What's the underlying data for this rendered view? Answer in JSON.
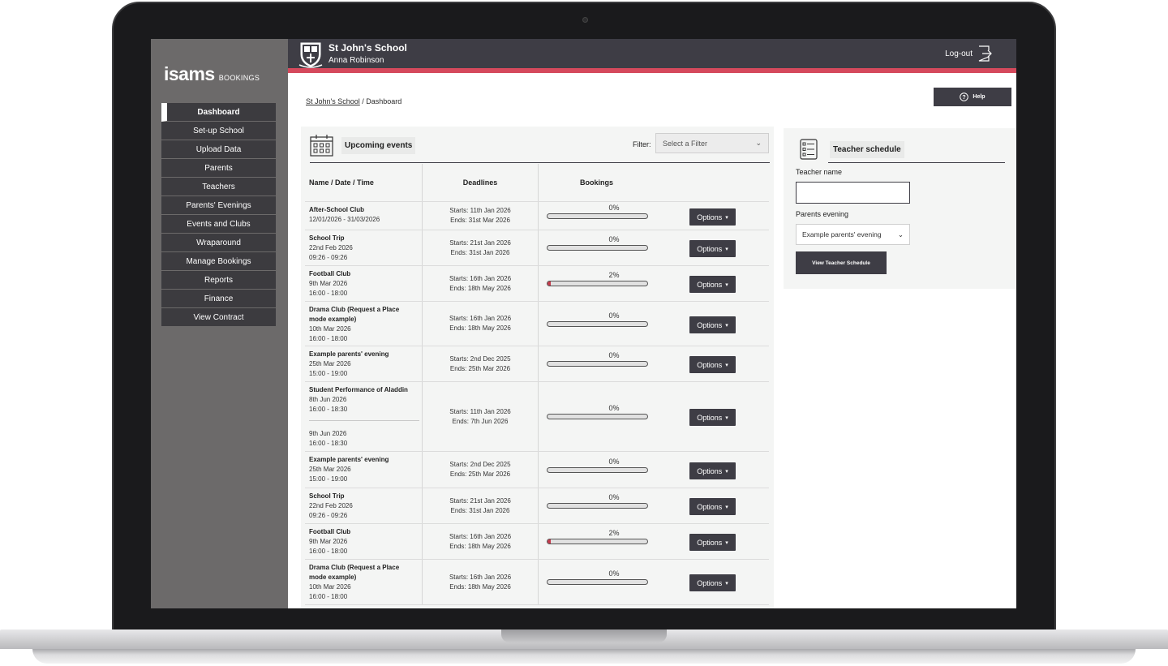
{
  "app": {
    "logo_main": "isams",
    "logo_sub": "BOOKINGS"
  },
  "sidebar": {
    "items": [
      {
        "label": "Dashboard"
      },
      {
        "label": "Set-up School"
      },
      {
        "label": "Upload Data"
      },
      {
        "label": "Parents"
      },
      {
        "label": "Teachers"
      },
      {
        "label": "Parents' Evenings"
      },
      {
        "label": "Events and Clubs"
      },
      {
        "label": "Wraparound"
      },
      {
        "label": "Manage Bookings"
      },
      {
        "label": "Reports"
      },
      {
        "label": "Finance"
      },
      {
        "label": "View Contract"
      }
    ],
    "active_index": 0
  },
  "header": {
    "school_name": "St John's School",
    "user_name": "Anna Robinson",
    "logout_label": "Log-out"
  },
  "breadcrumb": {
    "link": "St John's School",
    "separator": " / ",
    "current": "Dashboard"
  },
  "help": {
    "label": "Help"
  },
  "events": {
    "title": "Upcoming events",
    "filter_label": "Filter:",
    "filter_placeholder": "Select a Filter",
    "columns": {
      "name": "Name / Date / Time",
      "deadlines": "Deadlines",
      "bookings": "Bookings"
    },
    "options_label": "Options",
    "rows": [
      {
        "name": "After-School Club",
        "lines": [
          "12/01/2026 - 31/03/2026"
        ],
        "starts": "Starts: 11th Jan 2026",
        "ends": "Ends: 31st Mar 2026",
        "pct": "0%",
        "fill": 0
      },
      {
        "name": "School Trip",
        "lines": [
          "22nd Feb 2026",
          "09:26 - 09:26"
        ],
        "starts": "Starts: 21st Jan 2026",
        "ends": "Ends: 31st Jan 2026",
        "pct": "0%",
        "fill": 0
      },
      {
        "name": "Football Club",
        "lines": [
          "9th Mar 2026",
          "16:00 - 18:00"
        ],
        "starts": "Starts: 16th Jan 2026",
        "ends": "Ends: 18th May 2026",
        "pct": "2%",
        "fill": 0.02
      },
      {
        "name": "Drama Club (Request a Place mode example)",
        "lines": [
          "10th Mar 2026",
          "16:00 - 18:00"
        ],
        "starts": "Starts: 16th Jan 2026",
        "ends": "Ends: 18th May 2026",
        "pct": "0%",
        "fill": 0
      },
      {
        "name": "Example parents' evening",
        "lines": [
          "25th Mar 2026",
          "15:00 - 19:00"
        ],
        "starts": "Starts: 2nd Dec 2025",
        "ends": "Ends: 25th Mar 2026",
        "pct": "0%",
        "fill": 0
      },
      {
        "name": "Student Performance of Aladdin",
        "lines": [
          "8th Jun 2026",
          "16:00 - 18:30"
        ],
        "extra_lines": [
          "9th Jun 2026",
          "16:00 - 18:30"
        ],
        "starts": "Starts: 11th Jan 2026",
        "ends": "Ends: 7th Jun 2026",
        "pct": "0%",
        "fill": 0
      },
      {
        "name": "Example parents' evening",
        "lines": [
          "25th Mar 2026",
          "15:00 - 19:00"
        ],
        "starts": "Starts: 2nd Dec 2025",
        "ends": "Ends: 25th Mar 2026",
        "pct": "0%",
        "fill": 0
      },
      {
        "name": "School Trip",
        "lines": [
          "22nd Feb 2026",
          "09:26 - 09:26"
        ],
        "starts": "Starts: 21st Jan 2026",
        "ends": "Ends: 31st Jan 2026",
        "pct": "0%",
        "fill": 0
      },
      {
        "name": "Football Club",
        "lines": [
          "9th Mar 2026",
          "16:00 - 18:00"
        ],
        "starts": "Starts: 16th Jan 2026",
        "ends": "Ends: 18th May 2026",
        "pct": "2%",
        "fill": 0.02
      },
      {
        "name": "Drama Club (Request a Place mode example)",
        "lines": [
          "10th Mar 2026",
          "16:00 - 18:00"
        ],
        "starts": "Starts: 16th Jan 2026",
        "ends": "Ends: 18th May 2026",
        "pct": "0%",
        "fill": 0
      }
    ]
  },
  "teacher_schedule": {
    "title": "Teacher schedule",
    "teacher_name_label": "Teacher name",
    "teacher_name_value": "",
    "parents_evening_label": "Parents evening",
    "parents_evening_selected": "Example parents' evening",
    "button_label": "View Teacher Schedule"
  },
  "colors": {
    "dark": "#3e3d45",
    "accent": "#d5495c",
    "sidebar": "#6c6a6a",
    "panel": "#f4f5f4"
  }
}
